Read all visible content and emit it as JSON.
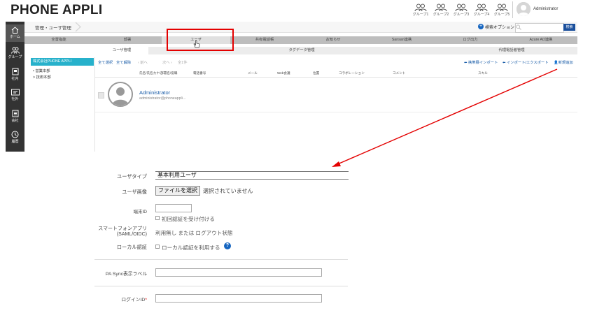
{
  "app": {
    "logo": "PHONE APPLI",
    "user": "Administrator"
  },
  "header_groups": [
    {
      "label": "グループ1"
    },
    {
      "label": "グループ2"
    },
    {
      "label": "グループ3"
    },
    {
      "label": "グループ4"
    },
    {
      "label": "グループ5"
    }
  ],
  "nav": [
    {
      "label": "ホーム",
      "icon": "home-icon"
    },
    {
      "label": "グループ",
      "icon": "group-icon"
    },
    {
      "label": "社内",
      "icon": "building-icon"
    },
    {
      "label": "社外",
      "icon": "contact-card-icon"
    },
    {
      "label": "会社",
      "icon": "office-icon"
    },
    {
      "label": "履歴",
      "icon": "history-icon"
    }
  ],
  "breadcrumb": "管理・ユーザ管理",
  "search": {
    "options_label": "検索オプション",
    "placeholder": "",
    "button": "検索"
  },
  "tabs_main": [
    "全置指能",
    "部署",
    "ユーザ",
    "共有電話帳",
    "お知らせ",
    "Sansan連携",
    "ログ出力",
    "Azure AD連携"
  ],
  "tabs_sub": [
    "ユーザ管理",
    "タグデータ管理",
    "代理電話者管理"
  ],
  "org": {
    "root": "株式会社PHONE APPLI",
    "items": [
      "営業本部",
      "技術本部"
    ]
  },
  "toolbar": {
    "select_all": "全て選択",
    "deselect_all": "全て解除",
    "prev": "前へ",
    "next": "次へ",
    "count": "全1件",
    "import": "携帯展インポート",
    "import_export": "インポート/エクスポート",
    "new": "新規追加"
  },
  "list_headers": [
    "氏名/氏名カナ/部署名/役職",
    "電話番号",
    "メール",
    "Web会議",
    "位置",
    "コラボレーション",
    "コメント",
    "スキル"
  ],
  "user_row": {
    "name": "Administrator",
    "email": "administrator@phoneappli..."
  },
  "form": {
    "user_type_label": "ユーザタイプ",
    "user_type_value": "基本利用ユーザ",
    "user_image_label": "ユーザ画像",
    "file_button": "ファイルを選択",
    "file_note": "選択されていません",
    "device_id_label": "端末ID",
    "first_auth": "初回認証を受け付ける",
    "smartphone_label_1": "スマートフォンアプリ",
    "smartphone_label_2": "(SAML/OIDC)",
    "smartphone_value": "利用無し または ログアウト状態",
    "local_auth_label": "ローカル認証",
    "local_auth_option": "ローカル認証を利用する",
    "pa_sync_label": "PA Sync表示ラベル",
    "login_id_label": "ログインID",
    "required_mark": "*"
  },
  "colors": {
    "accent_blue": "#1a5da8",
    "highlight_red": "#e40000",
    "org_teal": "#27b1cb",
    "nav_dark": "#333333"
  }
}
